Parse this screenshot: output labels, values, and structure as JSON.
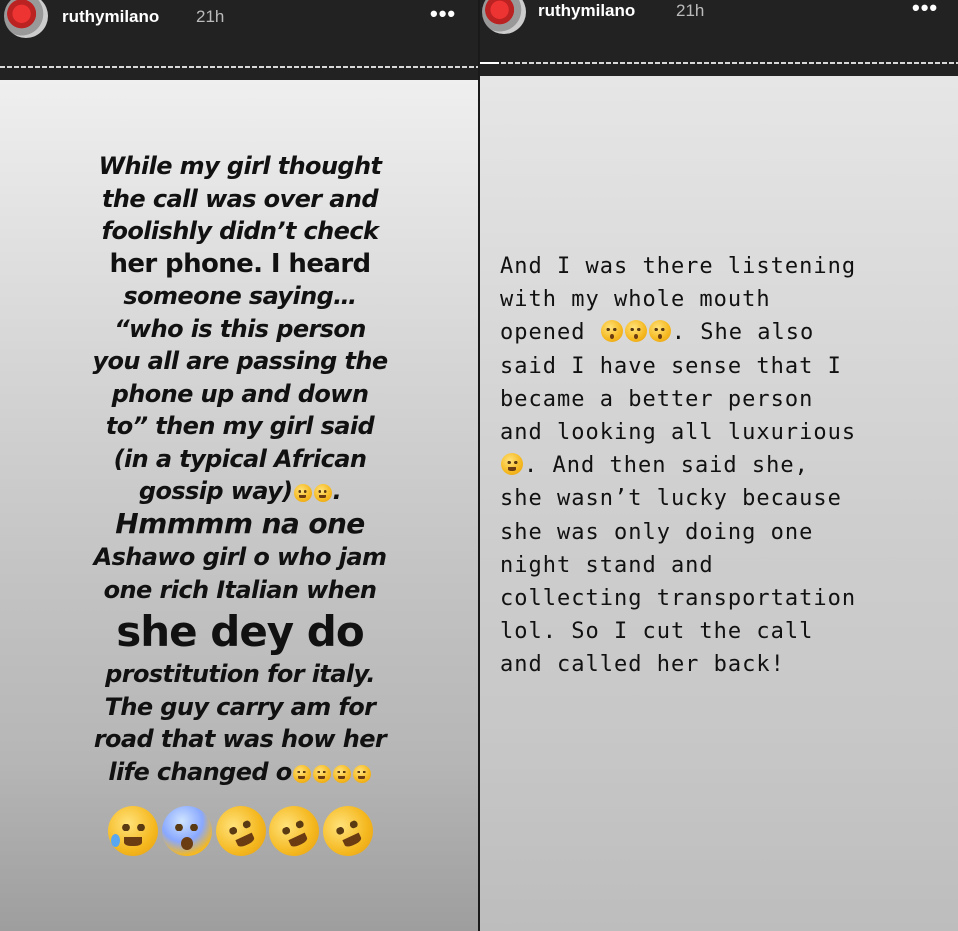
{
  "stories": [
    {
      "username": "ruthymilano",
      "time": "21h",
      "more_label": "•••",
      "text_lines": [
        "While my girl thought",
        "the call was over and",
        "foolishly didn’t check",
        "her phone. I heard",
        "someone saying…",
        "“who is this person",
        "you all are passing the",
        "phone up and down",
        "to” then my girl said",
        "(in a typical African",
        "gossip way)",
        "Hmmmm na one",
        "Ashawo girl o who jam",
        "one rich Italian when",
        "she dey do",
        "prostitution for italy.",
        "The guy carry am for",
        "road that was how her",
        "life changed o"
      ],
      "emoji_row": [
        "crying-face",
        "screaming-face",
        "rofl-face",
        "rofl-face",
        "rofl-face"
      ]
    },
    {
      "username": "ruthymilano",
      "time": "21h",
      "more_label": "•••",
      "text_lines": [
        "And I was there listening",
        "with my whole mouth",
        "opened",
        ". She also",
        "said I have sense that I",
        "became a better person",
        "and looking all luxurious",
        ". And then said she,",
        "she wasn’t lucky because",
        "she was only doing one",
        "night stand and",
        "collecting transportation",
        "lol. So I cut the call",
        "and called her back!"
      ]
    }
  ],
  "progress": [
    0.0,
    0.04
  ],
  "colors": {
    "emoji_yellow": "#f5b81f",
    "text": "#111111",
    "header_bg": "#222222"
  }
}
